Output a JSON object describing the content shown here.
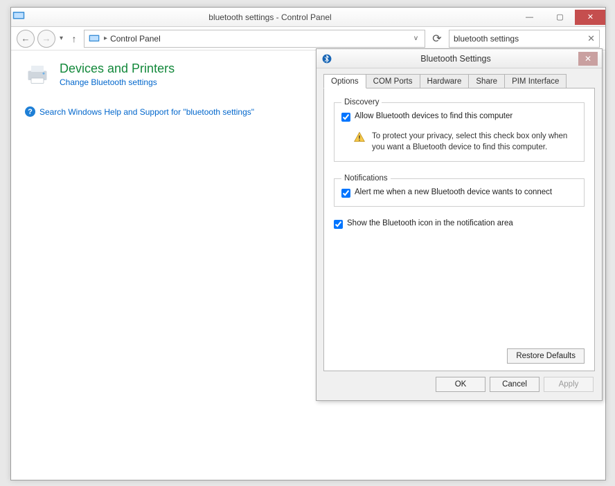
{
  "window": {
    "title": "bluetooth settings - Control Panel"
  },
  "address": {
    "root": "Control Panel"
  },
  "search": {
    "value": "bluetooth settings"
  },
  "result": {
    "heading": "Devices and Printers",
    "sublink": "Change Bluetooth settings"
  },
  "helplink": {
    "text": "Search Windows Help and Support for \"bluetooth settings\""
  },
  "dialog": {
    "title": "Bluetooth Settings",
    "tabs": {
      "options": "Options",
      "comports": "COM Ports",
      "hardware": "Hardware",
      "share": "Share",
      "pim": "PIM Interface"
    },
    "discovery": {
      "legend": "Discovery",
      "checkbox": "Allow Bluetooth devices to find this computer",
      "note": "To protect your privacy, select this check box only when you want a Bluetooth device to find this computer."
    },
    "notifications": {
      "legend": "Notifications",
      "checkbox": "Alert me when a new Bluetooth device wants to connect"
    },
    "showIcon": "Show the Bluetooth icon in the notification area",
    "restore": "Restore Defaults",
    "ok": "OK",
    "cancel": "Cancel",
    "apply": "Apply"
  }
}
